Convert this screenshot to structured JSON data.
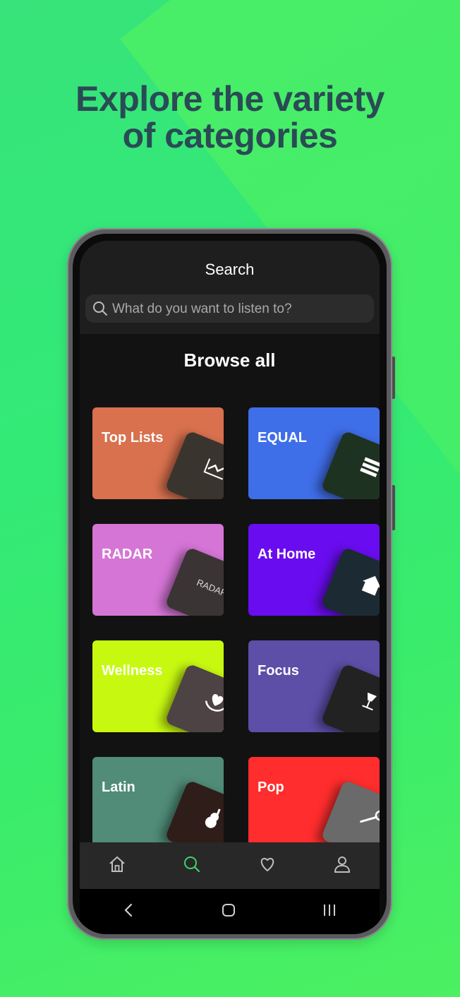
{
  "headline": {
    "line1": "Explore the variety",
    "line2": "of categories"
  },
  "app": {
    "title": "Search",
    "search": {
      "placeholder": "What do you want to listen to?",
      "value": ""
    },
    "browse_title": "Browse all",
    "categories": [
      {
        "label": "Top Lists",
        "color": "#d9714e",
        "art_color": "#3a342e",
        "icon": "trend-icon"
      },
      {
        "label": "EQUAL",
        "color": "#3f6ee9",
        "art_color": "#1e3221",
        "icon": "equal-bars-icon"
      },
      {
        "label": "RADAR",
        "color": "#d575d6",
        "art_color": "#3a3434",
        "icon": "radar-text-icon",
        "art_text": "RADAR"
      },
      {
        "label": "At Home",
        "color": "#6a0cf0",
        "art_color": "#1c2a33",
        "icon": "house-icon"
      },
      {
        "label": "Wellness",
        "color": "#c7f910",
        "art_color": "#4d4244",
        "icon": "heart-hands-icon"
      },
      {
        "label": "Focus",
        "color": "#5d4ea8",
        "art_color": "#222222",
        "icon": "lamp-icon"
      },
      {
        "label": "Latin",
        "color": "#508c78",
        "art_color": "#2e1d18",
        "icon": "guitar-icon"
      },
      {
        "label": "Pop",
        "color": "#ff2d2d",
        "art_color": "#6a6a6a",
        "icon": "microphone-icon"
      }
    ],
    "nav": [
      {
        "name": "home",
        "icon": "home-icon",
        "active": false
      },
      {
        "name": "search",
        "icon": "search-icon",
        "active": true
      },
      {
        "name": "favorites",
        "icon": "heart-icon",
        "active": false
      },
      {
        "name": "profile",
        "icon": "user-icon",
        "active": false
      }
    ],
    "accent_color": "#3fd268"
  }
}
